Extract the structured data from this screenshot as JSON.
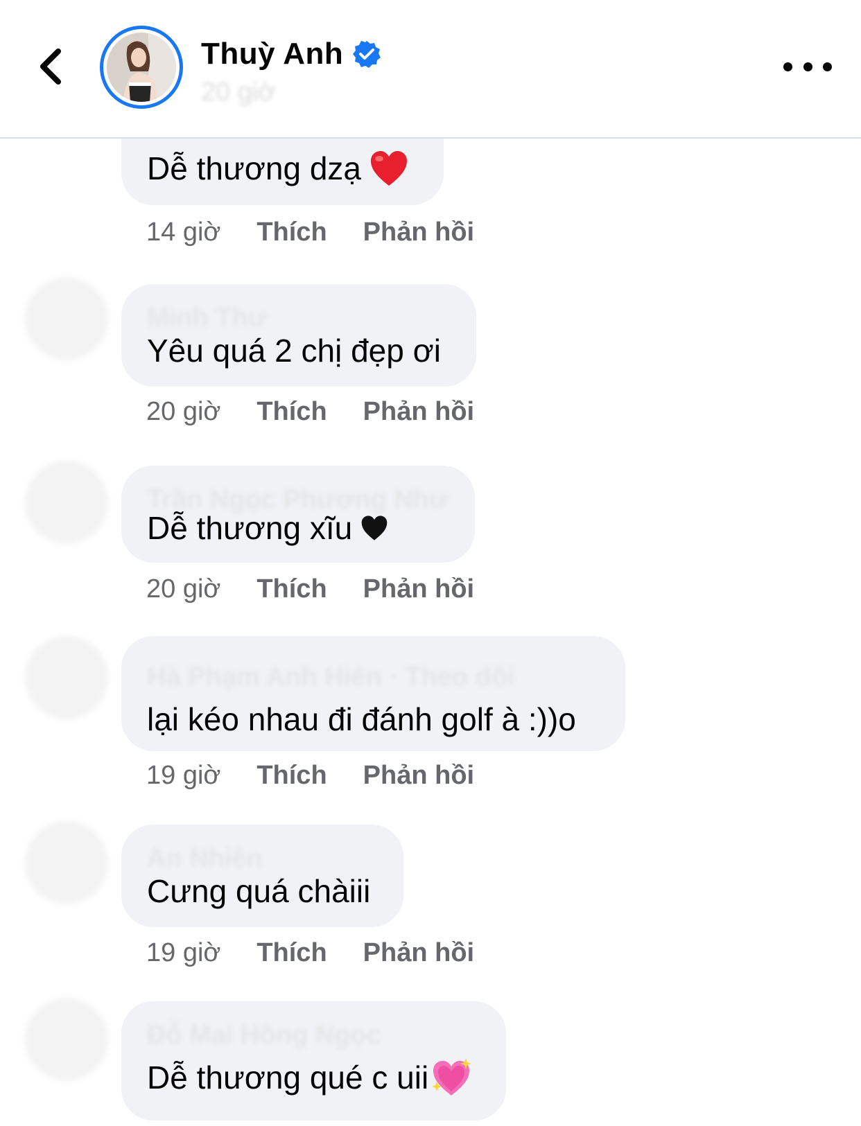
{
  "header": {
    "author_name": "Thuỳ Anh",
    "post_time": "20 giờ"
  },
  "actions_labels": {
    "like": "Thích",
    "reply": "Phản hồi"
  },
  "comments": [
    {
      "author": "",
      "text": "Dễ thương dzạ",
      "emoji": "red-heart",
      "time": "14 giờ"
    },
    {
      "author": "Minh Thư",
      "text": "Yêu quá 2 chị đẹp ơi",
      "emoji": "",
      "time": "20 giờ"
    },
    {
      "author": "Trần Ngọc Phương Như",
      "text": "Dễ thương xĩu",
      "emoji": "black-heart",
      "time": "20 giờ"
    },
    {
      "author": "Hà Phạm Anh Hiên · Theo dõi",
      "text": "lại kéo nhau đi đánh golf à :))o",
      "emoji": "",
      "time": "19 giờ"
    },
    {
      "author": "An Nhiên",
      "text": "Cưng quá chàiii",
      "emoji": "",
      "time": "19 giờ"
    },
    {
      "author": "Đỗ Mai Hồng Ngọc",
      "text": "Dễ thương qué c uii",
      "emoji": "sparkling-heart",
      "time": ""
    }
  ],
  "colors": {
    "accent": "#1877f2",
    "bubble": "#f0f2f5",
    "muted_text": "#65676b"
  }
}
